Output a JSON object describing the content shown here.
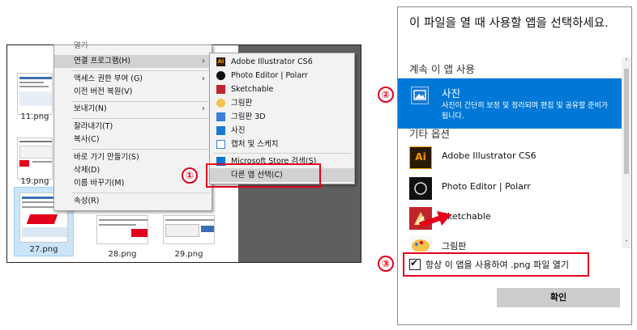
{
  "context_menu": {
    "top_label": "열기",
    "items": [
      {
        "label": "연결 프로그램(H)",
        "submenu": true
      },
      {
        "label": "액세스 권한 부여 (G)",
        "submenu": true
      },
      {
        "label": "이전 버전 복원(V)",
        "submenu": false
      },
      {
        "label": "보내기(N)",
        "submenu": true
      },
      {
        "label": "잘라내기(T)",
        "submenu": false
      },
      {
        "label": "복사(C)",
        "submenu": false
      },
      {
        "label": "바로 가기 만들기(S)",
        "submenu": false
      },
      {
        "label": "삭제(D)",
        "submenu": false
      },
      {
        "label": "이름 바꾸기(M)",
        "submenu": false
      },
      {
        "label": "속성(R)",
        "submenu": false
      }
    ],
    "arrow_glyph": "›"
  },
  "submenu": {
    "items": [
      "Adobe Illustrator CS6",
      "Photo Editor | Polarr",
      "Sketchable",
      "그림판",
      "그림판 3D",
      "사진",
      "캡처 및 스케치"
    ],
    "store_label": "Microsoft Store 검색(S)",
    "other_app_label": "다른 앱 선택(C)",
    "icons": {
      "illustrator": "Ai"
    }
  },
  "files": [
    {
      "name": "11.png"
    },
    {
      "name": "19.png"
    },
    {
      "name": "27.png"
    },
    {
      "name": "28.png"
    },
    {
      "name": "29.png"
    }
  ],
  "callouts": [
    "①",
    "②",
    "③"
  ],
  "dialog": {
    "title": "이 파일을 열 때 사용할 앱을 선택하세요.",
    "keep_section": "계속 이 앱 사용",
    "highlighted_app": {
      "name": "사진",
      "description": "사진이 간단히 보정 및 정리되며 편집 및 공유할 준비가 됩니다."
    },
    "other_section": "기타 옵션",
    "apps": [
      {
        "name": "Adobe Illustrator CS6",
        "icon_text": "Ai"
      },
      {
        "name": "Photo Editor | Polarr"
      },
      {
        "name": "Sketchable"
      },
      {
        "name": "그림판"
      }
    ],
    "always_use_label": "항상 이 앱을 사용하여 .png 파일 열기",
    "check_glyph": "✔",
    "confirm_label": "확인",
    "scroll_up": "˄",
    "scroll_down": "˅"
  },
  "colors": {
    "accent": "#0078d7",
    "callout_red": "#e3001b"
  }
}
